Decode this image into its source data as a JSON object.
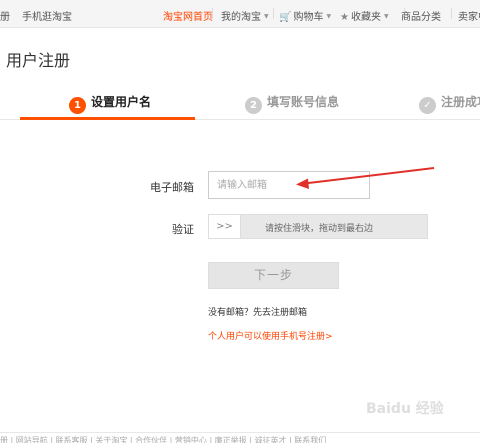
{
  "topbar": {
    "item1": "册",
    "item2": "手机逛淘宝",
    "home": "淘宝网首页",
    "mytaobao": "我的淘宝",
    "cart": "购物车",
    "favorites": "收藏夹",
    "categories": "商品分类",
    "seller": "卖家中"
  },
  "page": {
    "title": "用户注册"
  },
  "steps": [
    {
      "num": "1",
      "label": "设置用户名"
    },
    {
      "num": "2",
      "label": "填写账号信息"
    },
    {
      "num": "✓",
      "label": "注册成功"
    }
  ],
  "form": {
    "email_label": "电子邮箱",
    "email_placeholder": "请输入邮箱",
    "verify_label": "验证",
    "slider_handle": ">>",
    "slider_text": "请按住滑块，拖动到最右边",
    "next_button": "下一步",
    "no_email": "没有邮箱？先去注册邮箱",
    "mobile_link": "个人用户可以使用手机号注册>"
  },
  "footer": {
    "text": "册 | 网站导航 | 联系客服 | 关于淘宝 | 合作伙伴 | 营销中心 | 廉正举报 | 诚征英才 | 联系我们"
  },
  "watermark": {
    "text": "Baidu 经验"
  },
  "colors": {
    "accent": "#ff5000",
    "link": "#ff4400"
  }
}
